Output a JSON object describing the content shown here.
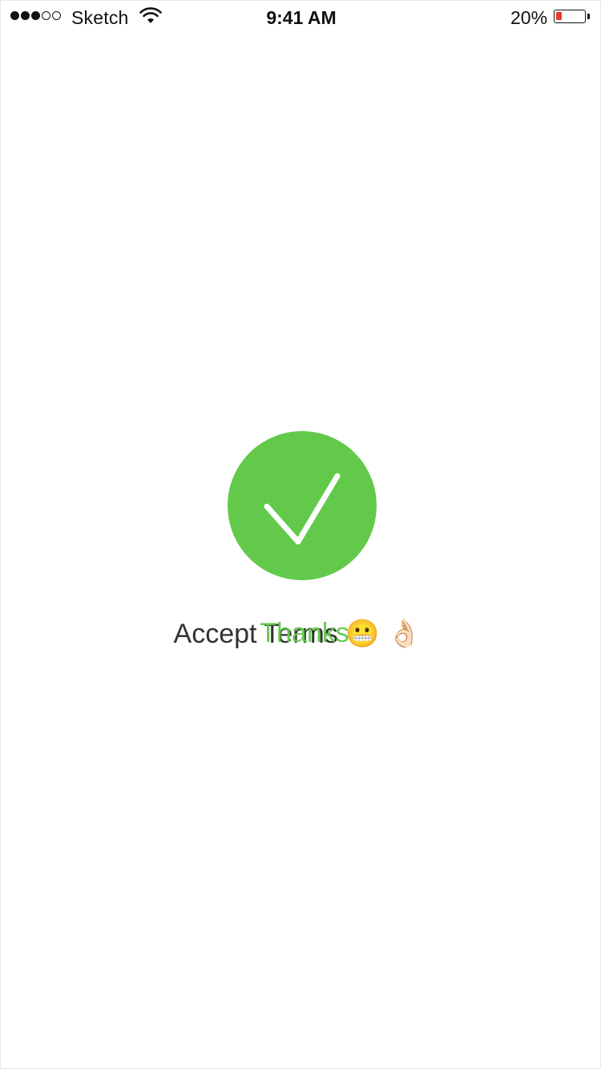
{
  "status_bar": {
    "signal_bars": 5,
    "signal_filled": 3,
    "carrier": "Sketch",
    "time": "9:41 AM",
    "battery_percent_label": "20%",
    "battery_level": 0.2,
    "battery_color": "#e83a2f"
  },
  "main": {
    "check_icon": "checkmark-icon",
    "check_circle_color": "#63c94b",
    "accept_text": "Accept Terms 😬 👌🏻",
    "thanks_text": "Thanks"
  }
}
